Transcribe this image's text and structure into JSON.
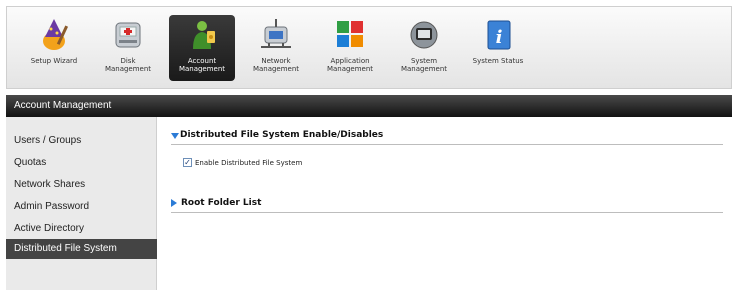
{
  "toolbar": {
    "items": [
      {
        "label": "Setup Wizard",
        "icon": "wizard-icon"
      },
      {
        "label": "Disk\nManagement",
        "icon": "disk-icon"
      },
      {
        "label": "Account\nManagement",
        "icon": "account-icon",
        "active": true
      },
      {
        "label": "Network\nManagement",
        "icon": "network-icon"
      },
      {
        "label": "Application\nManagement",
        "icon": "application-icon"
      },
      {
        "label": "System\nManagement",
        "icon": "system-icon"
      },
      {
        "label": "System Status",
        "icon": "info-icon"
      }
    ]
  },
  "section_band": {
    "title": "Account Management"
  },
  "sidebar": {
    "items": [
      {
        "label": "Users / Groups"
      },
      {
        "label": "Quotas"
      },
      {
        "label": "Network Shares"
      },
      {
        "label": "Admin Password"
      },
      {
        "label": "Active Directory"
      },
      {
        "label": "Distributed File System",
        "active": true
      }
    ]
  },
  "main": {
    "dfs_section": {
      "title": "Distributed File System Enable/Disables",
      "checkbox_label": "Enable Distributed File System",
      "checked": true
    },
    "root_section": {
      "title": "Root Folder List"
    }
  },
  "colors": {
    "accent": "#2b7bd6",
    "band": "#1e1e1e",
    "active_sidebar": "#444444"
  }
}
